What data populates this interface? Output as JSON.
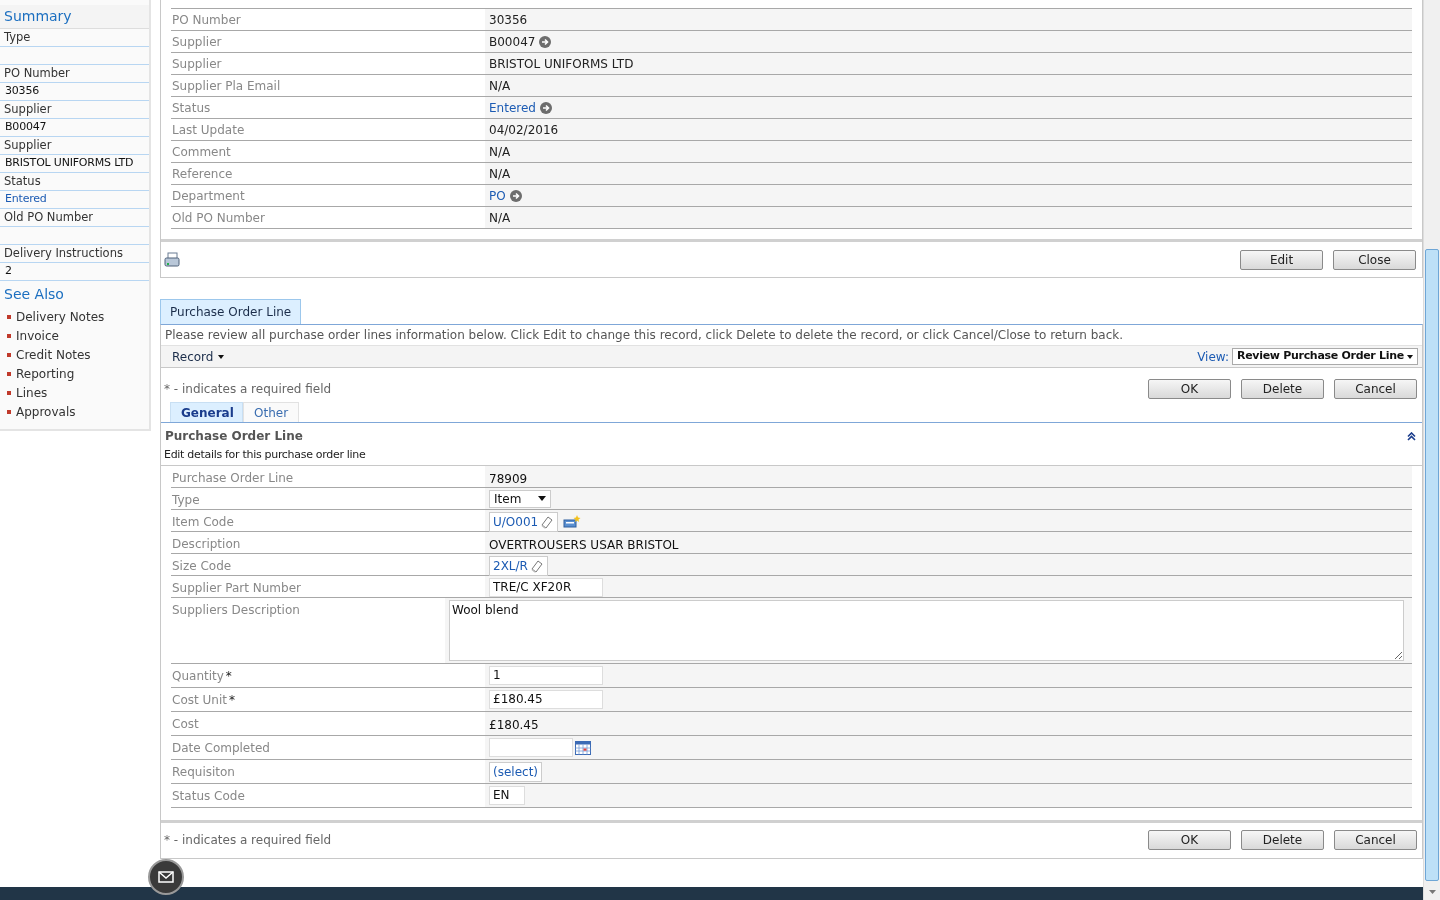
{
  "sidebar": {
    "summary_title": "Summary",
    "fields": [
      {
        "label": "Type"
      },
      {
        "label": "PO Number",
        "value": "30356",
        "kind": "plain"
      },
      {
        "label": "Supplier",
        "value": "B00047",
        "kind": "plain"
      },
      {
        "label": "Supplier",
        "value": "BRISTOL UNIFORMS LTD",
        "kind": "plain"
      },
      {
        "label": "Status",
        "value": "Entered",
        "kind": "link"
      },
      {
        "label": "Old PO Number"
      },
      {
        "label": "Delivery Instructions",
        "value": "2",
        "kind": "plain"
      }
    ],
    "see_also_title": "See Also",
    "links": [
      "Delivery Notes",
      "Invoice",
      "Credit Notes",
      "Reporting",
      "Lines",
      "Approvals"
    ]
  },
  "header_record": {
    "fields": [
      {
        "label": "PO Number",
        "value": "30356",
        "kind": "plain"
      },
      {
        "label": "Supplier",
        "value": "B00047",
        "kind": "goto"
      },
      {
        "label": "Supplier",
        "value": "BRISTOL UNIFORMS LTD",
        "kind": "plain"
      },
      {
        "label": "Supplier Pla Email",
        "value": "N/A",
        "kind": "plain"
      },
      {
        "label": "Status",
        "value": "Entered",
        "kind": "link"
      },
      {
        "label": "Last Update",
        "value": "04/02/2016",
        "kind": "plain"
      },
      {
        "label": "Comment",
        "value": "N/A",
        "kind": "plain"
      },
      {
        "label": "Reference",
        "value": "N/A",
        "kind": "plain"
      },
      {
        "label": "Department",
        "value": "PO",
        "kind": "link"
      },
      {
        "label": "Old PO Number",
        "value": "N/A",
        "kind": "plain"
      }
    ],
    "buttons": [
      "Edit",
      "Close"
    ]
  },
  "line_panel": {
    "tab": "Purchase Order Line",
    "instructions": "Please review all purchase order lines information below. Click Edit to change this record, click Delete to delete the record, or click Cancel/Close to return back.",
    "record_menu": "Record",
    "view_label": "View:",
    "view_value": "Review Purchase Order Line",
    "required_note": "* - indicates a required field",
    "buttons": [
      "OK",
      "Delete",
      "Cancel"
    ],
    "tabs": [
      {
        "label": "General",
        "selected": true
      },
      {
        "label": "Other",
        "selected": false
      }
    ],
    "required_mark": "*",
    "section_title": "Purchase Order Line",
    "section_subtitle": "Edit details for this purchase order line",
    "fields": [
      {
        "label": "Purchase Order Line",
        "value": "78909",
        "kind": "text",
        "required": false
      },
      {
        "label": "Type",
        "value": "Item",
        "kind": "select",
        "required": false
      },
      {
        "label": "Item Code",
        "value": "U/O001",
        "kind": "lookup_new",
        "required": false
      },
      {
        "label": "Description",
        "value": "OVERTROUSERS USAR BRISTOL",
        "kind": "text",
        "required": false
      },
      {
        "label": "Size Code",
        "value": "2XL/R",
        "kind": "lookup",
        "required": false
      },
      {
        "label": "Supplier Part Number",
        "value": "TRE/C XF20R",
        "kind": "input",
        "required": false
      },
      {
        "label": "Suppliers Description",
        "value": "Wool blend",
        "kind": "textarea",
        "required": false
      },
      {
        "label": "Quantity",
        "value": "1",
        "kind": "input",
        "required": true
      },
      {
        "label": "Cost Unit",
        "value": "£180.45",
        "kind": "input",
        "required": true
      },
      {
        "label": "Cost",
        "value": "£180.45",
        "kind": "text",
        "required": false
      },
      {
        "label": "Date Completed",
        "kind": "date",
        "required": false
      },
      {
        "label": "Requisiton",
        "value": "(select)",
        "kind": "picker",
        "required": false
      },
      {
        "label": "Status Code",
        "value": "EN",
        "kind": "short",
        "required": false
      }
    ],
    "footer_note": "* - indicates a required field",
    "footer_buttons": [
      "OK",
      "Delete",
      "Cancel"
    ]
  }
}
